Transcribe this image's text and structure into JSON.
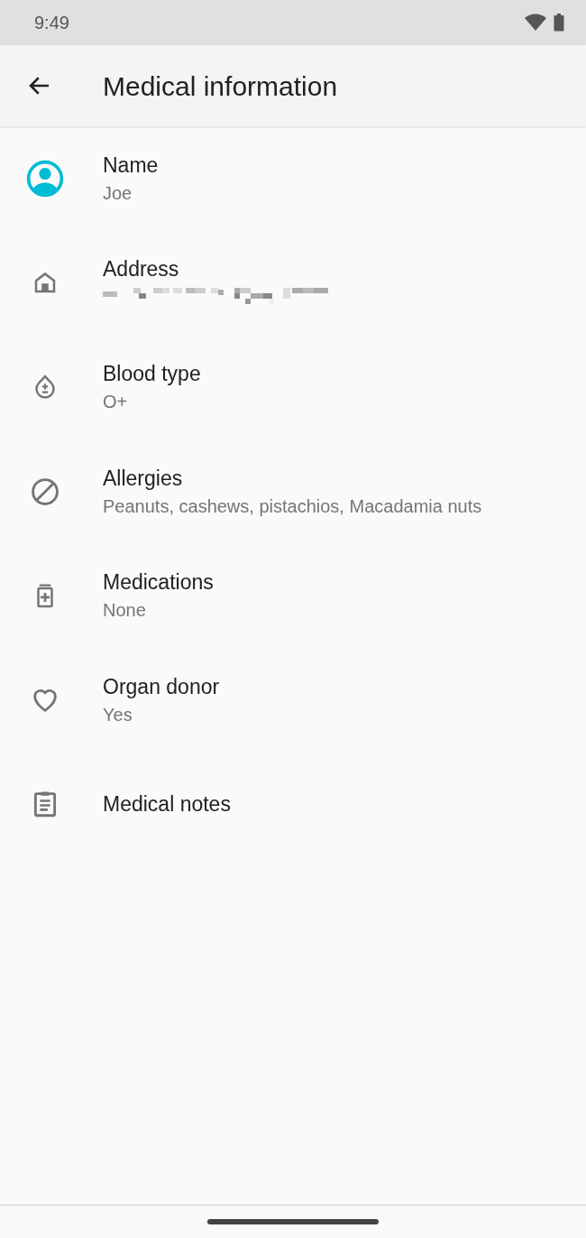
{
  "status_bar": {
    "time": "9:49"
  },
  "app_bar": {
    "title": "Medical information"
  },
  "items": [
    {
      "kind": "value",
      "label": "Name",
      "value": "Joe"
    },
    {
      "kind": "redacted",
      "label": "Address"
    },
    {
      "kind": "value",
      "label": "Blood type",
      "value": "O+"
    },
    {
      "kind": "value",
      "label": "Allergies",
      "value": "Peanuts, cashews, pistachios, Macadamia nuts"
    },
    {
      "kind": "value",
      "label": "Medications",
      "value": "None"
    },
    {
      "kind": "value",
      "label": "Organ donor",
      "value": "Yes"
    },
    {
      "kind": "label_only",
      "label": "Medical notes"
    }
  ]
}
